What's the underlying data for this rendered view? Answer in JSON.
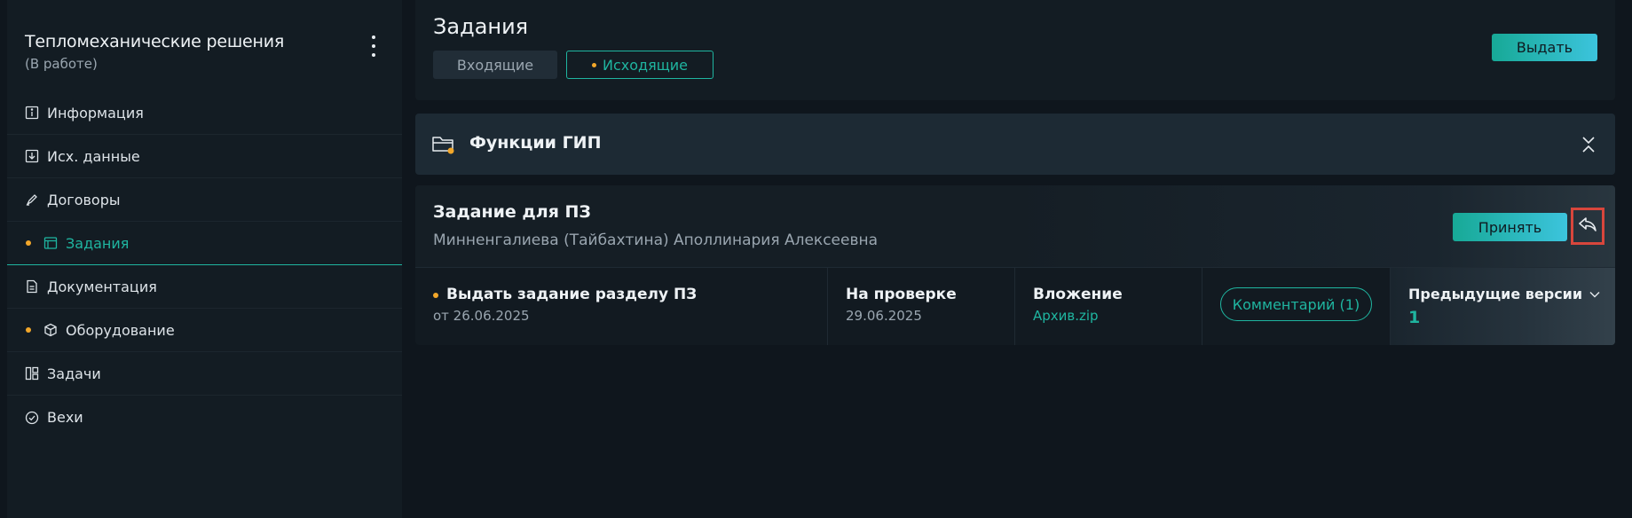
{
  "sidebar": {
    "project_title": "Тепломеханические решения",
    "project_status": "(В работе)",
    "items": [
      {
        "label": "Информация",
        "icon": "info-icon"
      },
      {
        "label": "Исх. данные",
        "icon": "download-icon"
      },
      {
        "label": "Договоры",
        "icon": "pen-icon"
      },
      {
        "label": "Задания",
        "icon": "tasks-icon",
        "active": true,
        "dot": true
      },
      {
        "label": "Документация",
        "icon": "document-icon"
      },
      {
        "label": "Оборудование",
        "icon": "cube-icon",
        "dot": true
      },
      {
        "label": "Задачи",
        "icon": "board-icon"
      },
      {
        "label": "Вехи",
        "icon": "check-circle-icon"
      }
    ]
  },
  "header": {
    "title": "Задания",
    "tabs": [
      {
        "label": "Входящие"
      },
      {
        "label": "Исходящие",
        "active": true
      }
    ],
    "issue_button": "Выдать"
  },
  "section": {
    "title": "Функции ГИП"
  },
  "task": {
    "title": "Задание для ПЗ",
    "person": "Минненгалиева (Тайбахтина) Аполлинария Алексеевна",
    "accept_button": "Принять",
    "name": "Выдать задание разделу ПЗ",
    "date": "от 26.06.2025",
    "status": "На проверке",
    "status_date": "29.06.2025",
    "attachment_label": "Вложение",
    "attachment_file": "Архив.zip",
    "comment_button": "Комментарий (1)",
    "prev_versions_label": "Предыдущие версии",
    "prev_versions_count": "1"
  },
  "colors": {
    "accent": "#1fb5a0",
    "dot": "#f2a72a",
    "highlight": "#d8463c"
  }
}
